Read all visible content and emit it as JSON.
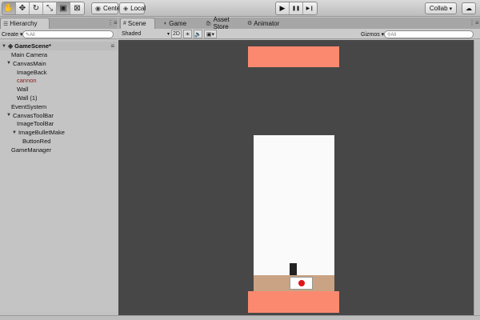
{
  "toolbar": {
    "tools": [
      {
        "name": "hand-tool",
        "icon": "hand-icon",
        "glyph": "✋"
      },
      {
        "name": "move-tool",
        "icon": "move-icon",
        "glyph": "✥"
      },
      {
        "name": "rotate-tool",
        "icon": "rotate-icon",
        "glyph": "↻"
      },
      {
        "name": "scale-tool",
        "icon": "scale-icon",
        "glyph": "⤡"
      },
      {
        "name": "rect-tool",
        "icon": "rect-icon",
        "glyph": "▣"
      },
      {
        "name": "transform-tool",
        "icon": "transform-icon",
        "glyph": "⊠"
      }
    ],
    "pivot_label": "Center",
    "pivot_icon": "◉",
    "space_label": "Local",
    "space_icon": "◈",
    "play_glyph": "▶",
    "pause_glyph": "❚❚",
    "step_glyph": "▶❙",
    "collab_label": "Collab",
    "collab_caret": "▾",
    "cloud_glyph": "☁"
  },
  "hierarchy": {
    "tab_label": "Hierarchy",
    "tab_icon": "☰",
    "create_label": "Create ▾",
    "search_placeholder": "✎All",
    "search_icon": "⚲",
    "scene_name": "GameScene*",
    "items": [
      {
        "label": "Main Camera",
        "depth": 1,
        "expandable": false,
        "red": false
      },
      {
        "label": "CanvasMain",
        "depth": 1,
        "expandable": true,
        "red": false
      },
      {
        "label": "ImageBack",
        "depth": 2,
        "expandable": false,
        "red": false
      },
      {
        "label": "cannon",
        "depth": 2,
        "expandable": false,
        "red": true
      },
      {
        "label": "Wall",
        "depth": 2,
        "expandable": false,
        "red": false
      },
      {
        "label": "Wall (1)",
        "depth": 2,
        "expandable": false,
        "red": false
      },
      {
        "label": "EventSystem",
        "depth": 1,
        "expandable": false,
        "red": false
      },
      {
        "label": "CanvasToolBar",
        "depth": 1,
        "expandable": true,
        "red": false
      },
      {
        "label": "ImageToolBar",
        "depth": 2,
        "expandable": false,
        "red": false
      },
      {
        "label": "ImageBulletMake",
        "depth": 2,
        "expandable": true,
        "red": false
      },
      {
        "label": "ButtonRed",
        "depth": 3,
        "expandable": false,
        "red": false
      },
      {
        "label": "GameManager",
        "depth": 1,
        "expandable": false,
        "red": false
      }
    ]
  },
  "scene_view": {
    "tabs": [
      {
        "label": "Scene",
        "icon": "#",
        "active": true
      },
      {
        "label": "Game",
        "icon": "◐",
        "active": false
      },
      {
        "label": "Asset Store",
        "icon": "🛍",
        "active": false
      },
      {
        "label": "Animator",
        "icon": "⚙",
        "active": false
      }
    ],
    "shading_mode": "Shaded",
    "mode_2d": "2D",
    "gizmos_label": "Gizmos ▾",
    "search_placeholder": "⚲All",
    "colors": {
      "background": "#474747",
      "wall": "#fa8970",
      "playfield": "#fafafa",
      "ground": "#c9a383",
      "cannon": "#222222",
      "button_white": "#ffffff",
      "button_red": "#e0151a"
    }
  }
}
